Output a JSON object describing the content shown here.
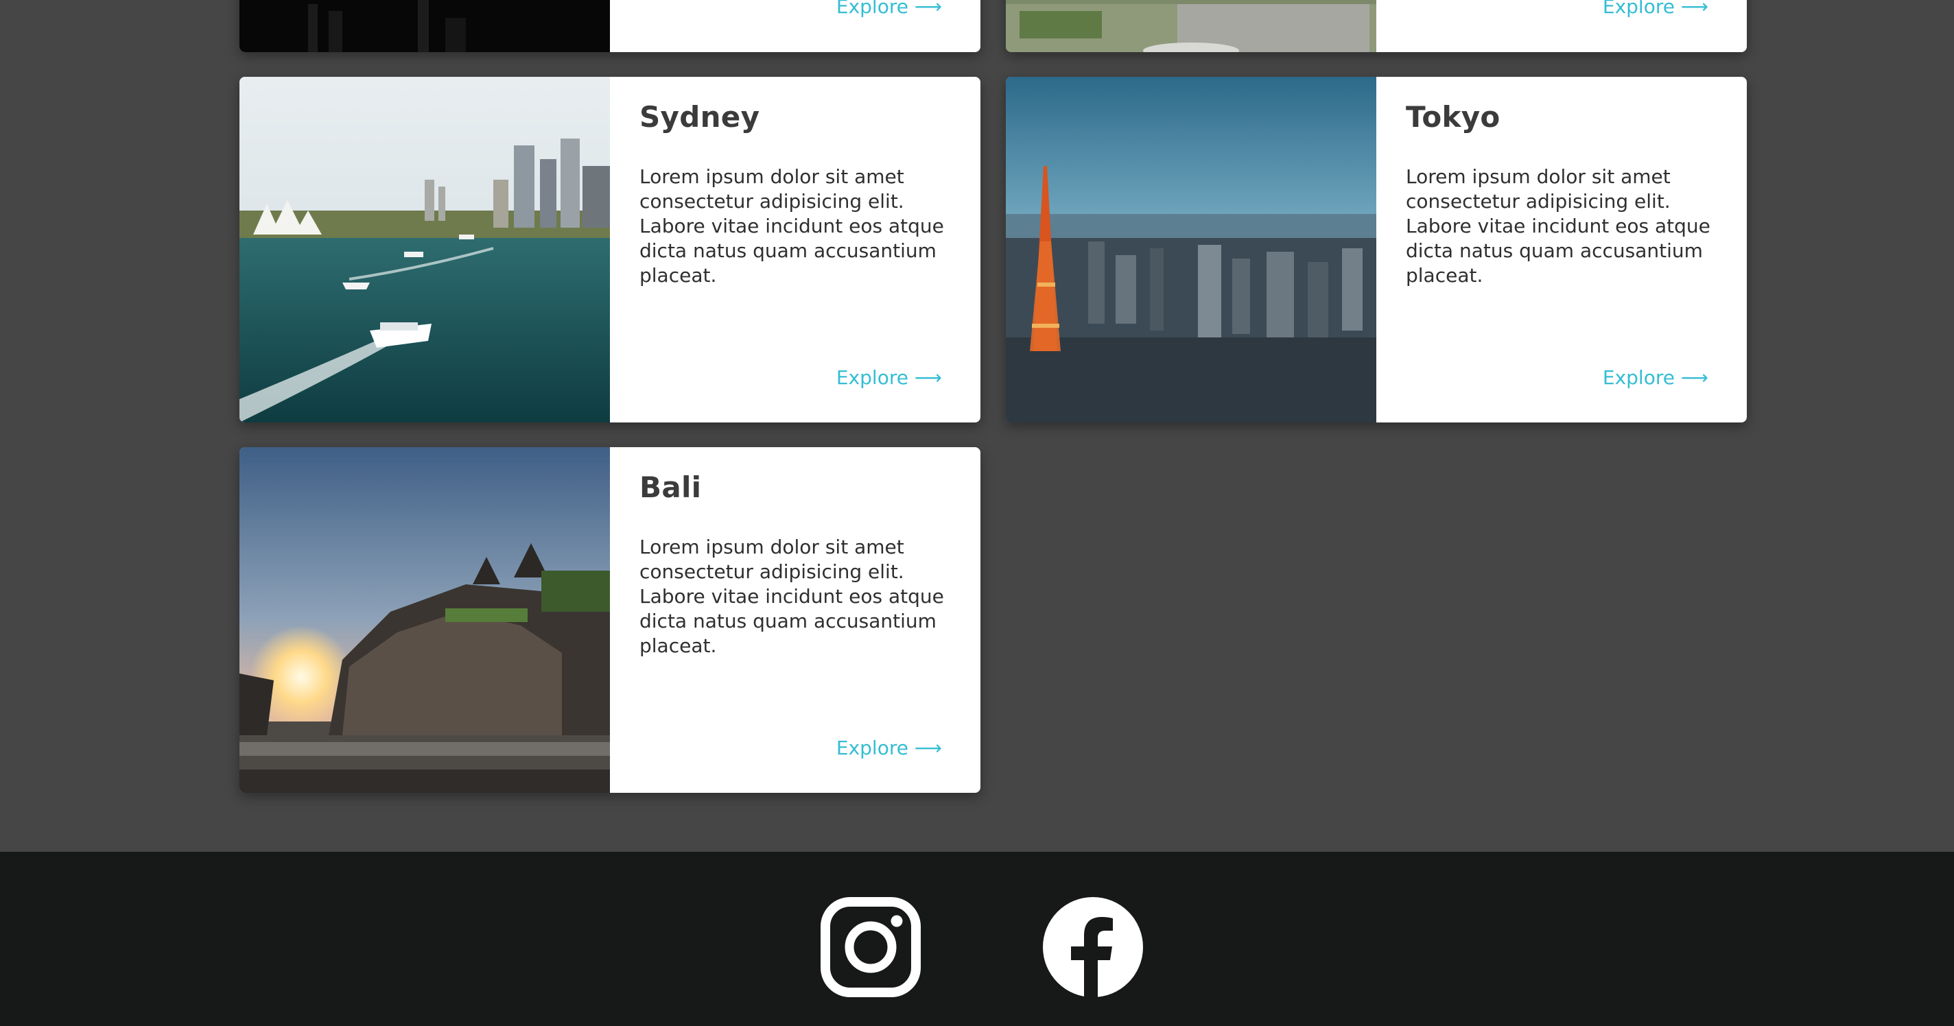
{
  "colors": {
    "background": "#464646",
    "card": "#ffffff",
    "link": "#35bdd4",
    "footer": "#171818"
  },
  "top_cards": [
    {
      "explore_label": "Explore ⟶"
    },
    {
      "explore_label": "Explore ⟶"
    }
  ],
  "cards": [
    {
      "title": "Sydney",
      "description": "Lorem ipsum dolor sit amet consectetur adipisicing elit. Labore vitae incidunt eos atque dicta natus quam accusantium placeat.",
      "explore_label": "Explore ⟶"
    },
    {
      "title": "Tokyo",
      "description": "Lorem ipsum dolor sit amet consectetur adipisicing elit. Labore vitae incidunt eos atque dicta natus quam accusantium placeat.",
      "explore_label": "Explore ⟶"
    },
    {
      "title": "Bali",
      "description": "Lorem ipsum dolor sit amet consectetur adipisicing elit. Labore vitae incidunt eos atque dicta natus quam accusantium placeat.",
      "explore_label": "Explore ⟶"
    }
  ],
  "footer": {
    "icons": [
      "instagram-icon",
      "facebook-icon"
    ]
  }
}
